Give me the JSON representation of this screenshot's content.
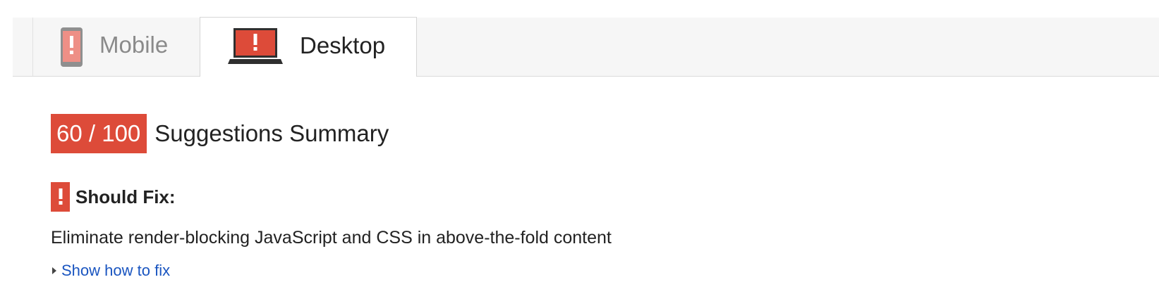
{
  "tabs": {
    "mobile": {
      "label": "Mobile",
      "icon": "mobile-warning-icon"
    },
    "desktop": {
      "label": "Desktop",
      "icon": "desktop-warning-icon",
      "active": true
    }
  },
  "score": {
    "value": "60 / 100",
    "title": "Suggestions Summary",
    "badge_color": "#dd4b39"
  },
  "should_fix": {
    "icon": "exclamation-icon",
    "label": "Should Fix:"
  },
  "rule": {
    "title": "Eliminate render-blocking JavaScript and CSS in above-the-fold content",
    "toggle_label": "Show how to fix"
  },
  "colors": {
    "accent_red": "#dd4b39",
    "link_blue": "#1a55c0",
    "text": "#222222"
  }
}
